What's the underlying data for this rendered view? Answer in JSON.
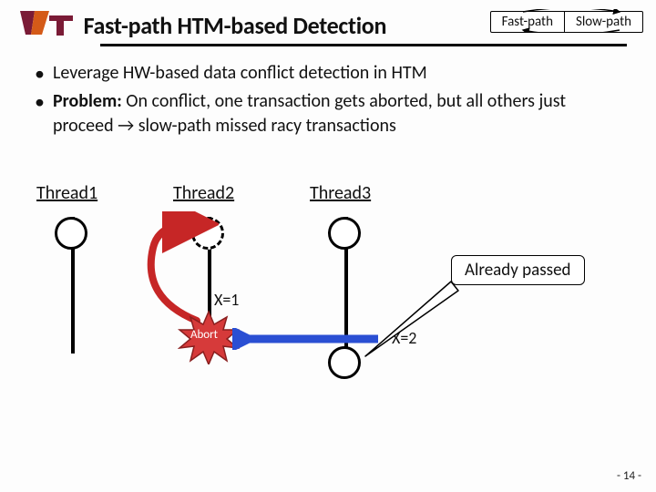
{
  "header": {
    "logo_alt": "VT logo",
    "title": "Fast-path HTM-based Detection"
  },
  "legend": {
    "fast": "Fast-path",
    "slow": "Slow-path"
  },
  "bullets": {
    "b1": "Leverage HW-based data conflict detection in HTM",
    "b2_lead": "Problem:",
    "b2_rest": " On conflict, one transaction gets aborted, but all others just proceed → slow-path missed racy transactions"
  },
  "threads": {
    "t1": "Thread1",
    "t2": "Thread2",
    "t3": "Thread3"
  },
  "x1": "X=1",
  "x2": "X=2",
  "abort": "Abort",
  "callout": "Already passed",
  "pagenum": "- 14 -"
}
